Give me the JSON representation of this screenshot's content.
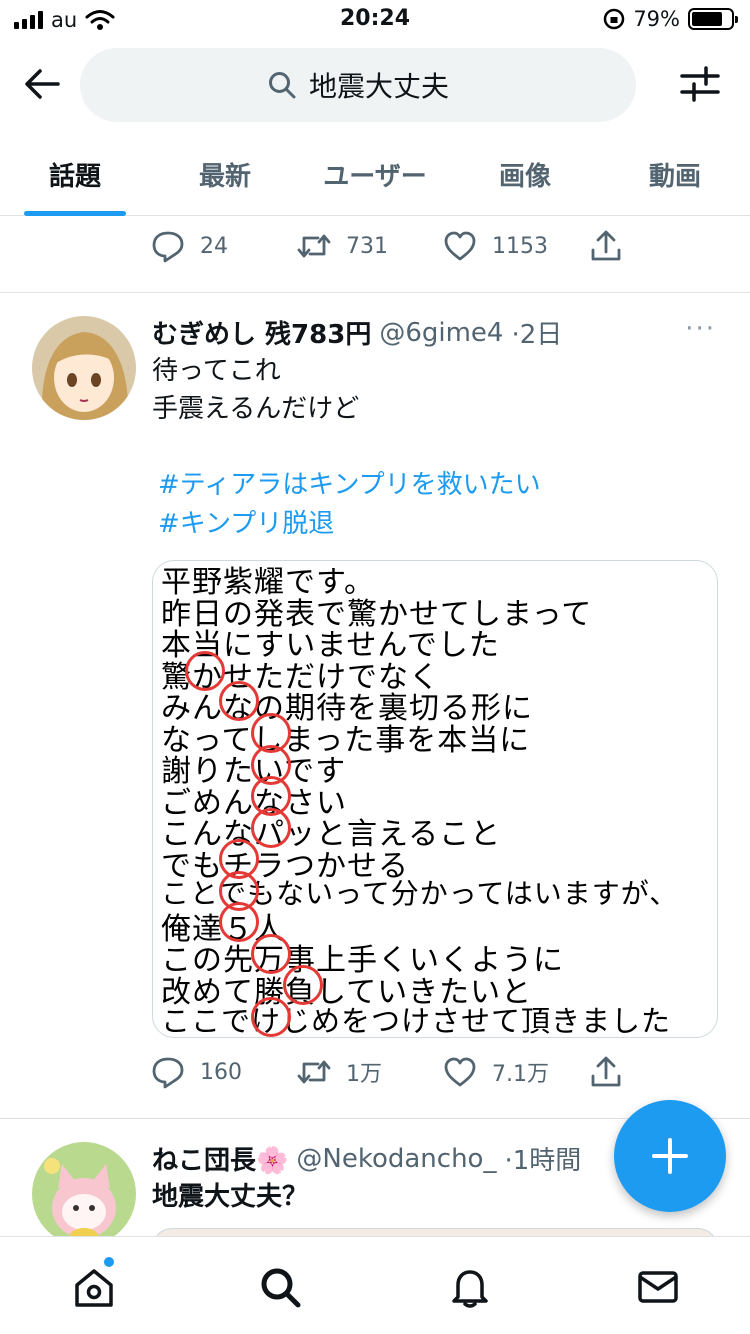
{
  "status_bar": {
    "carrier": "au",
    "time": "20:24",
    "battery": "79%",
    "battery_level": 0.79
  },
  "search": {
    "query": "地震大丈夫"
  },
  "tabs": [
    {
      "label": "話題",
      "active": true
    },
    {
      "label": "最新",
      "active": false
    },
    {
      "label": "ユーザー",
      "active": false
    },
    {
      "label": "画像",
      "active": false
    },
    {
      "label": "動画",
      "active": false
    }
  ],
  "prev_tweet": {
    "replies": "24",
    "retweets": "731",
    "likes": "1153"
  },
  "tweet": {
    "name": "むぎめし 残783円",
    "handle": "@6gime4",
    "time": "·2日",
    "more": "···",
    "lines": [
      "待ってこれ",
      "手震えるんだけど"
    ],
    "hashtags": [
      "#ティアラはキンプリを救いたい",
      "#キンプリ脱退"
    ],
    "image_lines": [
      "平野紫耀です。",
      "昨日の発表で驚かせてしまって",
      "本当にすいませんでした",
      "驚かせただけでなく",
      "みんなの期待を裏切る形に",
      "なってしまった事を本当に",
      "謝りたいです",
      "ごめんなさい",
      "こんなパッと言えること",
      "でもチラつかせる",
      "ことでもないって分かってはいますが、",
      "俺達５人",
      "この先万事上手くいくように",
      "改めて勝負していきたいと",
      "ここでけじめをつけさせて頂きました"
    ],
    "replies": "160",
    "retweets": "1万",
    "likes": "7.1万"
  },
  "next_tweet": {
    "name": "ねこ団長🌸",
    "handle": "@Nekodancho_",
    "time": "·1時間",
    "text": "地震大丈夫？"
  },
  "colors": {
    "accent": "#1d9bf0",
    "muted": "#536471",
    "circle": "#e53935"
  },
  "icons": [
    "back-arrow-icon",
    "search-icon",
    "filter-icon",
    "reply-icon",
    "retweet-icon",
    "like-icon",
    "share-icon",
    "compose-plus-icon",
    "home-icon",
    "explore-search-icon",
    "notifications-bell-icon",
    "messages-envelope-icon"
  ]
}
